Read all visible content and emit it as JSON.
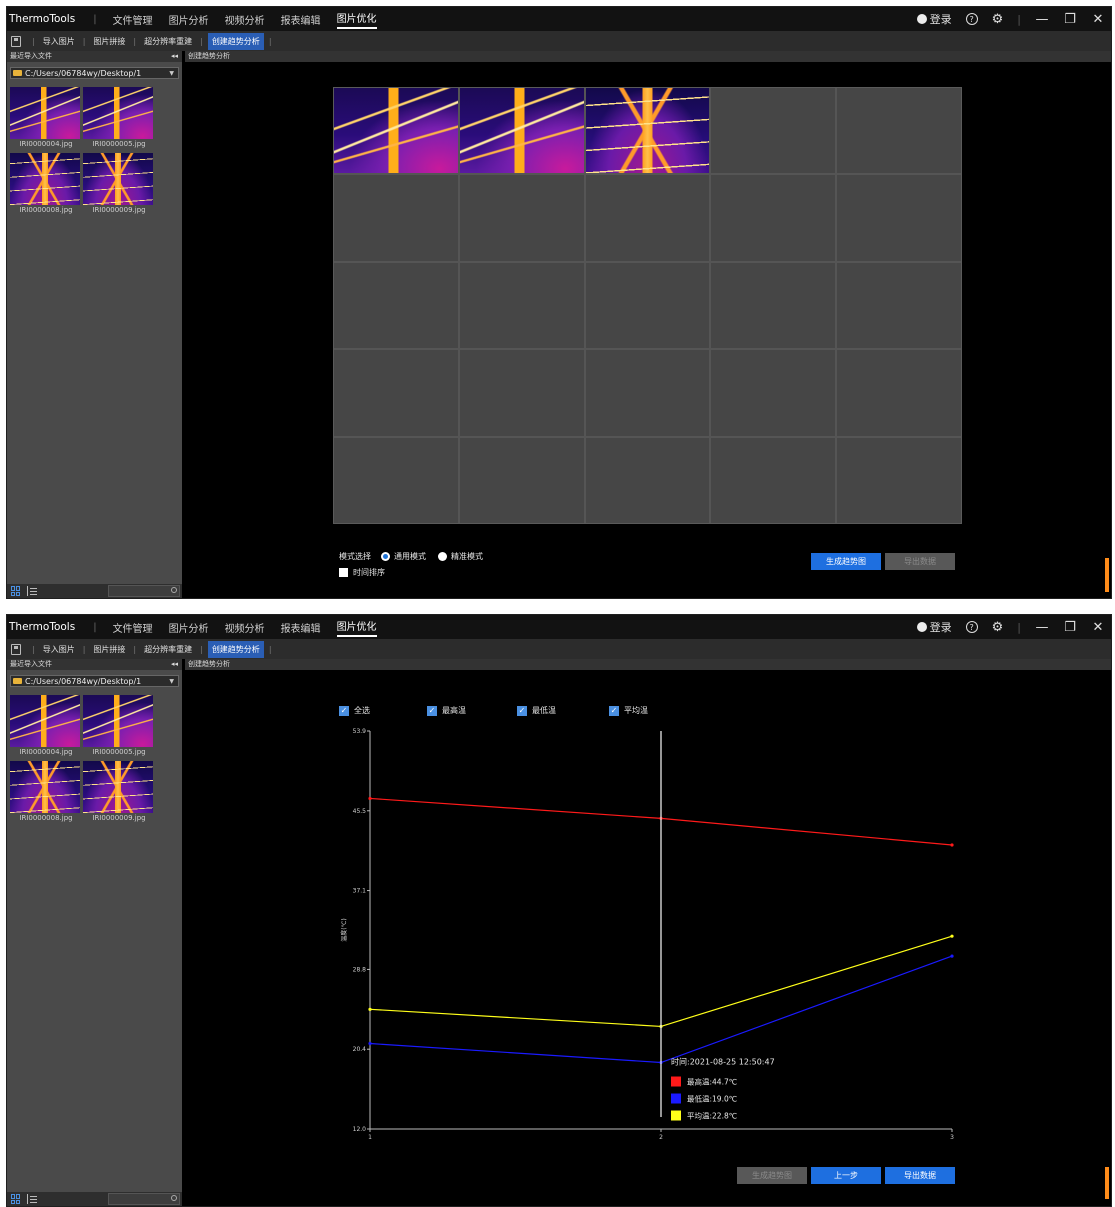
{
  "app": {
    "name": "ThermoTools",
    "menus": [
      "文件管理",
      "图片分析",
      "视频分析",
      "报表编辑",
      "图片优化"
    ],
    "active_menu": "图片优化",
    "login": "登录"
  },
  "toolbar": {
    "items": [
      "导入图片",
      "图片拼接",
      "超分辨率重建",
      "创建趋势分析"
    ],
    "active": "创建趋势分析"
  },
  "left_panel": {
    "title": "最近导入文件",
    "path": "C:/Users/06784wy/Desktop/1",
    "files": [
      "IRI0000004.jpg",
      "IRI0000005.jpg",
      "IRI0000008.jpg",
      "IRI0000009.jpg"
    ]
  },
  "main": {
    "header": "创建趋势分析"
  },
  "step1": {
    "mode_label": "模式选择",
    "mode_general": "通用模式",
    "mode_precise": "精准模式",
    "time_sort": "时间排序",
    "generate_button": "生成趋势图",
    "export_button": "导出数据"
  },
  "step2": {
    "checks": [
      "全选",
      "最高温",
      "最低温",
      "平均温"
    ],
    "generate_button": "生成趋势图",
    "prev_button": "上一步",
    "export_button": "导出数据"
  },
  "colors": {
    "accent": "#1e6fe0",
    "max": "#ff1a1a",
    "min": "#1a1aff",
    "avg": "#ffff1a"
  },
  "chart_data": {
    "type": "line",
    "x": [
      1,
      2,
      3
    ],
    "y_ticks": [
      "12.0",
      "20.4",
      "28.8",
      "37.1",
      "45.5",
      "53.9"
    ],
    "ylim": [
      12.0,
      53.9
    ],
    "ylabel": "温度(℃)",
    "series": [
      {
        "name": "最高温",
        "color": "#ff1a1a",
        "values": [
          46.8,
          44.7,
          41.9
        ]
      },
      {
        "name": "最低温",
        "color": "#1a1aff",
        "values": [
          21.0,
          19.0,
          30.2
        ]
      },
      {
        "name": "平均温",
        "color": "#ffff1a",
        "values": [
          24.6,
          22.8,
          32.3
        ]
      }
    ],
    "cursor_x": 2,
    "tooltip": {
      "time": "时间:2021-08-25 12:50:47",
      "rows": [
        "最高温:44.7℃",
        "最低温:19.0℃",
        "平均温:22.8℃"
      ]
    }
  }
}
